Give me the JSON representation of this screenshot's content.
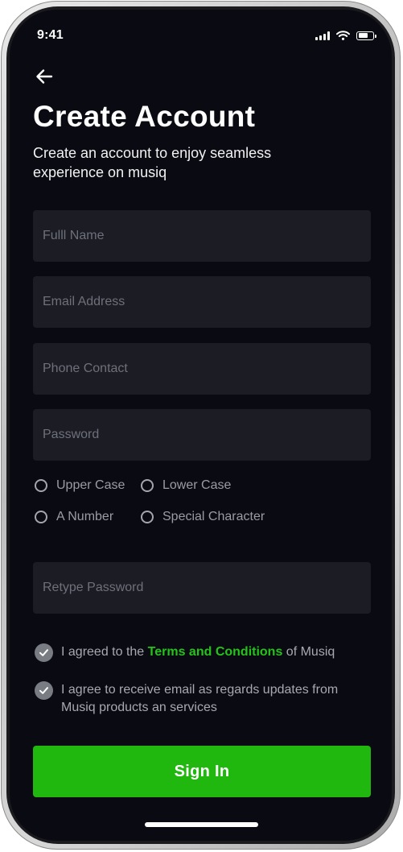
{
  "status_bar": {
    "time": "9:41"
  },
  "header": {
    "title": "Create Account",
    "subtitle": "Create an account to enjoy seamless experience on musiq"
  },
  "form": {
    "full_name_placeholder": "Fulll Name",
    "email_placeholder": "Email Address",
    "phone_placeholder": "Phone Contact",
    "password_placeholder": "Password",
    "retype_placeholder": "Retype Password"
  },
  "password_requirements": {
    "upper_case": "Upper Case",
    "lower_case": "Lower Case",
    "number": "A Number",
    "special_character": "Special Character"
  },
  "agreements": {
    "terms_prefix": "I agreed to the ",
    "terms_link": "Terms and Conditions",
    "terms_suffix": " of Musiq",
    "email_updates": "I agree to receive email as regards updates from Musiq products an services"
  },
  "actions": {
    "sign_in": "Sign In"
  },
  "colors": {
    "background": "#0a0b12",
    "input_background": "#1b1c24",
    "accent": "#20b80f",
    "link": "#25c21c"
  }
}
